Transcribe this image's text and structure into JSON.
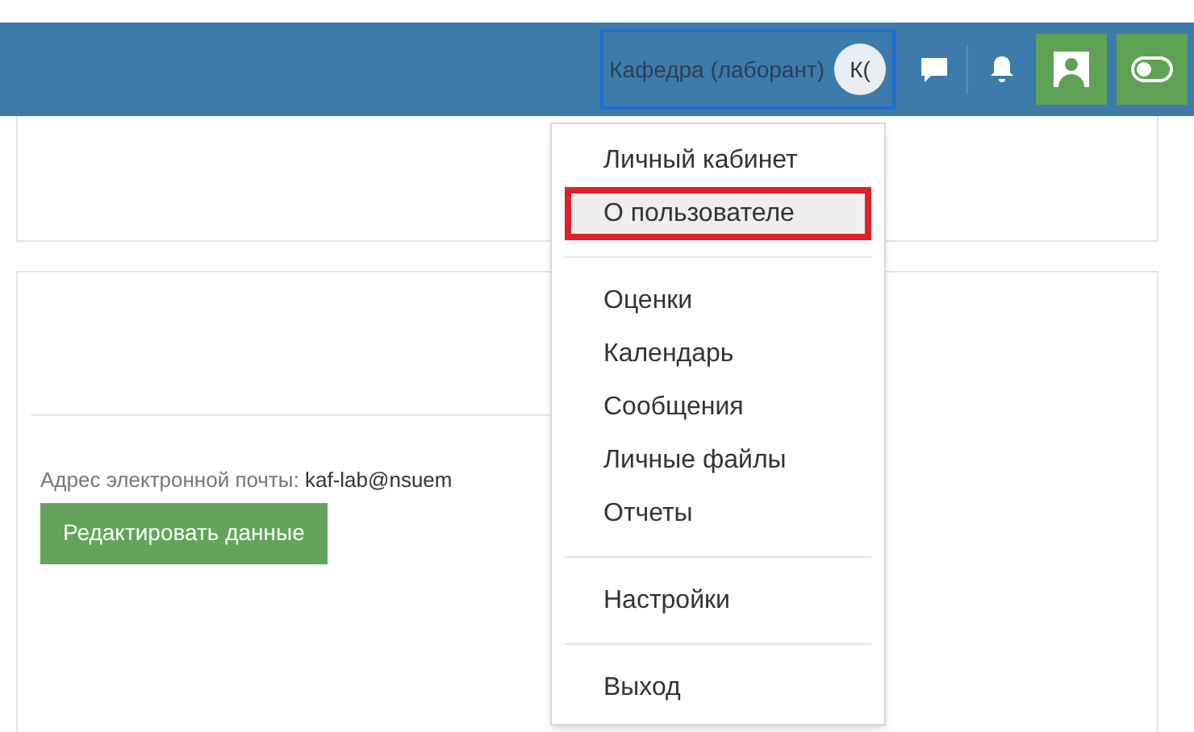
{
  "header": {
    "user_name": "Кафедра (лаборант)",
    "avatar_initials": "К("
  },
  "profile": {
    "email_label": "Адрес электронной почты:",
    "email_value": "kaf-lab@nsuem",
    "edit_button": "Редактировать данные"
  },
  "user_menu": {
    "groups": [
      [
        {
          "label": "Личный кабинет",
          "selected": false
        },
        {
          "label": "О пользователе",
          "selected": true
        }
      ],
      [
        {
          "label": "Оценки",
          "selected": false
        },
        {
          "label": "Календарь",
          "selected": false
        },
        {
          "label": "Сообщения",
          "selected": false
        },
        {
          "label": "Личные файлы",
          "selected": false
        },
        {
          "label": "Отчеты",
          "selected": false
        }
      ],
      [
        {
          "label": "Настройки",
          "selected": false
        }
      ],
      [
        {
          "label": "Выход",
          "selected": false
        }
      ]
    ]
  }
}
